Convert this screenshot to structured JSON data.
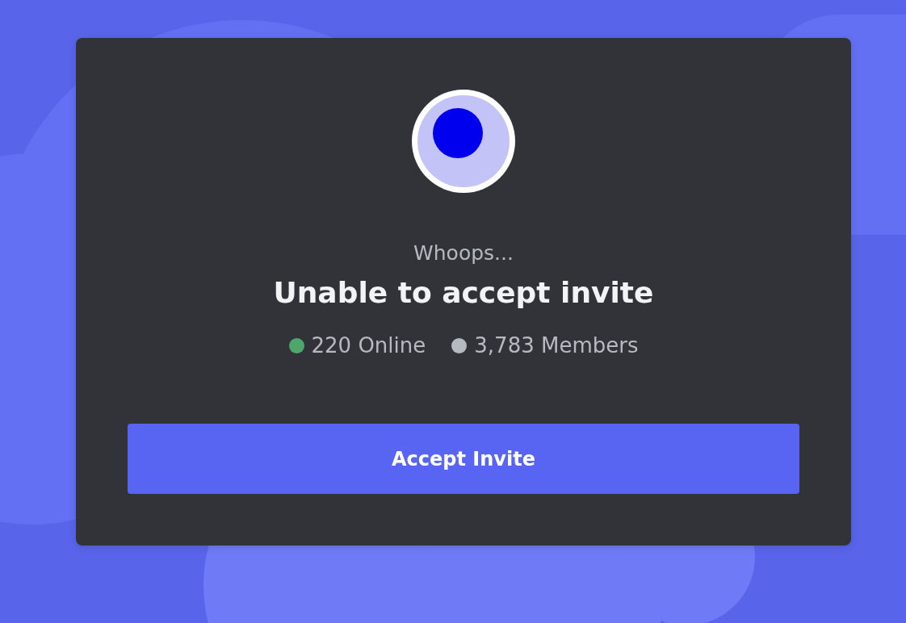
{
  "invite": {
    "eyebrow": "Whoops...",
    "title": "Unable to accept invite",
    "stats": [
      {
        "label": "220 Online",
        "color": "#4fa66a"
      },
      {
        "label": "3,783 Members",
        "color": "#b5bac1"
      }
    ],
    "button": {
      "label": "Accept Invite"
    }
  }
}
